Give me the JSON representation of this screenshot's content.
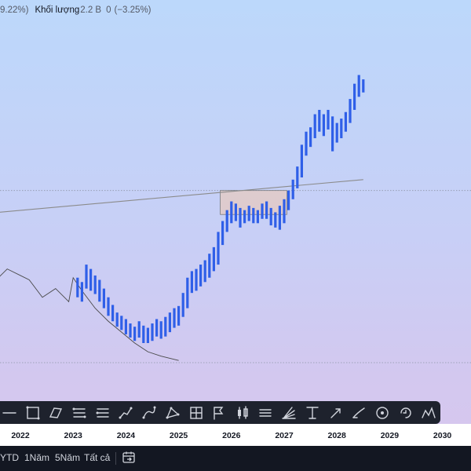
{
  "legend": {
    "change_partial": "9.22%)",
    "volume_label": "Khối lượng",
    "volume_value": "2.2 B",
    "volume_second": "0",
    "volume_change": "(−3.25%)"
  },
  "x_axis": {
    "ticks": [
      "2022",
      "2023",
      "2024",
      "2025",
      "2026",
      "2027",
      "2028",
      "2029",
      "2030"
    ]
  },
  "range_bar": {
    "buttons": [
      "YTD",
      "1Năm",
      "5Năm",
      "Tất cả"
    ]
  },
  "toolbar": {
    "icons": [
      "horizontal-ray-icon",
      "rectangle-icon",
      "parallel-channel-icon",
      "fib-retracement-icon",
      "pitchfork-icon",
      "path-icon",
      "polyline-icon",
      "triangle-pattern-icon",
      "xabcd-pattern-icon",
      "long-position-icon",
      "price-range-icon",
      "flag-icon",
      "bars-pattern-icon",
      "trend-line-icon",
      "fib-time-zone-icon",
      "parallel-lines-icon",
      "gann-fan-icon",
      "anchored-text-icon",
      "arrow-marker-icon",
      "brush-icon",
      "target-icon",
      "cycle-icon",
      "head-shoulders-icon"
    ]
  },
  "colors": {
    "bars": "#2f5fe8",
    "history_line": "#4a4a4a",
    "trend_line": "#8b8b8b",
    "box_fill": "#e6c9c0",
    "toolbar_bg": "#1e222d",
    "range_bar_bg": "#131722"
  },
  "chart_data": {
    "type": "ohlc",
    "title": "",
    "x_range": [
      "2021-08",
      "2030-06"
    ],
    "history_line": [
      [
        "2021-08",
        250
      ],
      [
        "2021-10",
        258
      ],
      [
        "2022-01",
        252
      ],
      [
        "2022-03",
        248
      ],
      [
        "2022-06",
        232
      ],
      [
        "2022-09",
        240
      ],
      [
        "2022-12",
        228
      ],
      [
        "2023-01",
        250
      ],
      [
        "2023-03",
        238
      ],
      [
        "2023-06",
        222
      ],
      [
        "2023-09",
        210
      ],
      [
        "2023-12",
        200
      ],
      [
        "2024-03",
        190
      ],
      [
        "2024-06",
        182
      ],
      [
        "2024-09",
        178
      ],
      [
        "2024-12",
        175
      ],
      [
        "2025-01",
        174
      ]
    ],
    "bars": [
      {
        "d": "2023-02",
        "h": 250,
        "l": 232
      },
      {
        "d": "2023-03",
        "h": 246,
        "l": 228
      },
      {
        "d": "2023-04",
        "h": 262,
        "l": 240
      },
      {
        "d": "2023-05",
        "h": 258,
        "l": 238
      },
      {
        "d": "2023-06",
        "h": 252,
        "l": 235
      },
      {
        "d": "2023-07",
        "h": 248,
        "l": 228
      },
      {
        "d": "2023-08",
        "h": 240,
        "l": 222
      },
      {
        "d": "2023-09",
        "h": 232,
        "l": 215
      },
      {
        "d": "2023-10",
        "h": 225,
        "l": 210
      },
      {
        "d": "2023-11",
        "h": 218,
        "l": 205
      },
      {
        "d": "2023-12",
        "h": 215,
        "l": 202
      },
      {
        "d": "2024-01",
        "h": 212,
        "l": 198
      },
      {
        "d": "2024-02",
        "h": 208,
        "l": 195
      },
      {
        "d": "2024-03",
        "h": 205,
        "l": 192
      },
      {
        "d": "2024-04",
        "h": 210,
        "l": 195
      },
      {
        "d": "2024-05",
        "h": 206,
        "l": 190
      },
      {
        "d": "2024-06",
        "h": 204,
        "l": 190
      },
      {
        "d": "2024-07",
        "h": 208,
        "l": 192
      },
      {
        "d": "2024-08",
        "h": 212,
        "l": 196
      },
      {
        "d": "2024-09",
        "h": 210,
        "l": 194
      },
      {
        "d": "2024-10",
        "h": 214,
        "l": 196
      },
      {
        "d": "2024-11",
        "h": 218,
        "l": 200
      },
      {
        "d": "2024-12",
        "h": 222,
        "l": 204
      },
      {
        "d": "2025-01",
        "h": 224,
        "l": 206
      },
      {
        "d": "2025-02",
        "h": 236,
        "l": 214
      },
      {
        "d": "2025-03",
        "h": 250,
        "l": 222
      },
      {
        "d": "2025-04",
        "h": 256,
        "l": 236
      },
      {
        "d": "2025-05",
        "h": 258,
        "l": 238
      },
      {
        "d": "2025-06",
        "h": 262,
        "l": 242
      },
      {
        "d": "2025-07",
        "h": 266,
        "l": 246
      },
      {
        "d": "2025-08",
        "h": 272,
        "l": 250
      },
      {
        "d": "2025-09",
        "h": 278,
        "l": 256
      },
      {
        "d": "2025-10",
        "h": 292,
        "l": 262
      },
      {
        "d": "2025-11",
        "h": 302,
        "l": 280
      },
      {
        "d": "2025-12",
        "h": 312,
        "l": 292
      },
      {
        "d": "2026-01",
        "h": 320,
        "l": 300
      },
      {
        "d": "2026-02",
        "h": 318,
        "l": 302
      },
      {
        "d": "2026-03",
        "h": 314,
        "l": 296
      },
      {
        "d": "2026-04",
        "h": 312,
        "l": 300
      },
      {
        "d": "2026-05",
        "h": 316,
        "l": 302
      },
      {
        "d": "2026-06",
        "h": 314,
        "l": 300
      },
      {
        "d": "2026-07",
        "h": 312,
        "l": 300
      },
      {
        "d": "2026-08",
        "h": 318,
        "l": 304
      },
      {
        "d": "2026-09",
        "h": 320,
        "l": 304
      },
      {
        "d": "2026-10",
        "h": 314,
        "l": 298
      },
      {
        "d": "2026-11",
        "h": 310,
        "l": 296
      },
      {
        "d": "2026-12",
        "h": 316,
        "l": 294
      },
      {
        "d": "2027-01",
        "h": 322,
        "l": 300
      },
      {
        "d": "2027-02",
        "h": 330,
        "l": 312
      },
      {
        "d": "2027-03",
        "h": 340,
        "l": 322
      },
      {
        "d": "2027-04",
        "h": 352,
        "l": 332
      },
      {
        "d": "2027-05",
        "h": 372,
        "l": 342
      },
      {
        "d": "2027-06",
        "h": 384,
        "l": 362
      },
      {
        "d": "2027-07",
        "h": 388,
        "l": 370
      },
      {
        "d": "2027-08",
        "h": 400,
        "l": 378
      },
      {
        "d": "2027-09",
        "h": 404,
        "l": 384
      },
      {
        "d": "2027-10",
        "h": 400,
        "l": 380
      },
      {
        "d": "2027-11",
        "h": 404,
        "l": 386
      },
      {
        "d": "2027-12",
        "h": 398,
        "l": 366
      },
      {
        "d": "2028-01",
        "h": 392,
        "l": 374
      },
      {
        "d": "2028-02",
        "h": 396,
        "l": 378
      },
      {
        "d": "2028-03",
        "h": 402,
        "l": 384
      },
      {
        "d": "2028-04",
        "h": 414,
        "l": 392
      },
      {
        "d": "2028-05",
        "h": 428,
        "l": 404
      },
      {
        "d": "2028-06",
        "h": 436,
        "l": 416
      },
      {
        "d": "2028-07",
        "h": 432,
        "l": 420
      }
    ],
    "trend_line": [
      [
        "2021-08",
        310
      ],
      [
        "2028-07",
        340
      ]
    ],
    "horizontal_lines": [
      330,
      172
    ],
    "box": {
      "from": "2025-11",
      "to": "2026-12",
      "high": 330,
      "low": 308
    },
    "grid": false,
    "x_ticks": [
      "2022",
      "2023",
      "2024",
      "2025",
      "2026",
      "2027",
      "2028",
      "2029",
      "2030"
    ]
  }
}
